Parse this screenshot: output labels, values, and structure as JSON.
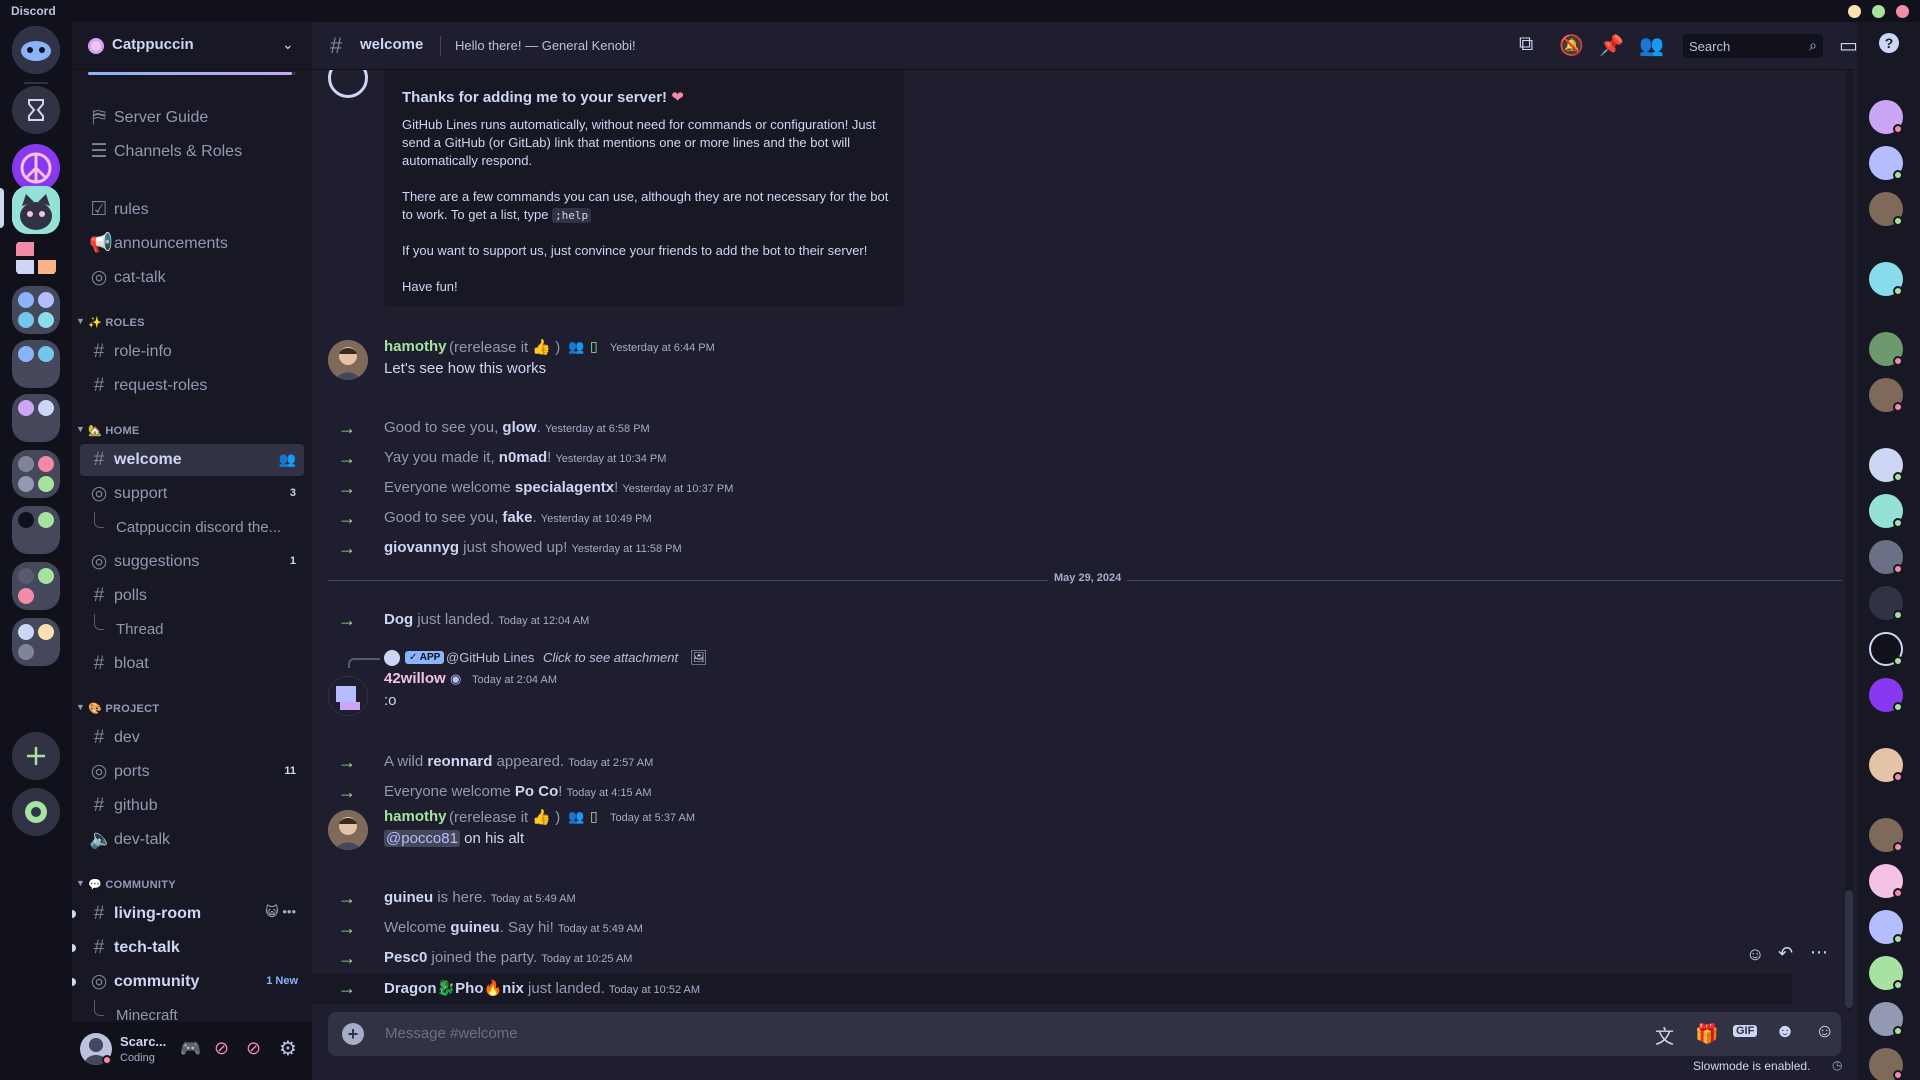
{
  "app": {
    "name": "Discord"
  },
  "server": {
    "name": "Catppuccin"
  },
  "sidebar": {
    "top_items": [
      {
        "label": "Server Guide",
        "icon": "signpost-icon"
      },
      {
        "label": "Channels & Roles",
        "icon": "list-search-icon"
      }
    ],
    "channels_top": [
      {
        "label": "rules",
        "icon": "checkbox-icon"
      },
      {
        "label": "announcements",
        "icon": "megaphone-icon"
      },
      {
        "label": "cat-talk",
        "icon": "forum-icon"
      }
    ],
    "categories": [
      {
        "label": "ROLES",
        "emoji": "✨",
        "channels": [
          {
            "label": "role-info",
            "icon": "hash-icon"
          },
          {
            "label": "request-roles",
            "icon": "hash-icon"
          }
        ]
      },
      {
        "label": "HOME",
        "emoji": "🏡",
        "channels": [
          {
            "label": "welcome",
            "icon": "hash-icon",
            "active": true
          },
          {
            "label": "support",
            "icon": "forum-icon",
            "count": "3"
          },
          {
            "label": "Catppuccin discord the...",
            "thread": true
          },
          {
            "label": "suggestions",
            "icon": "forum-icon",
            "count": "1"
          },
          {
            "label": "polls",
            "icon": "hash-icon"
          },
          {
            "label": "Thread",
            "thread": true
          },
          {
            "label": "bloat",
            "icon": "hash-icon"
          }
        ]
      },
      {
        "label": "PROJECT",
        "emoji": "🎨",
        "channels": [
          {
            "label": "dev",
            "icon": "hash-icon"
          },
          {
            "label": "ports",
            "icon": "forum-icon",
            "count": "11"
          },
          {
            "label": "github",
            "icon": "hash-icon"
          },
          {
            "label": "dev-talk",
            "icon": "speaker-icon"
          }
        ]
      },
      {
        "label": "COMMUNITY",
        "emoji": "💬",
        "channels": [
          {
            "label": "living-room",
            "icon": "hash-icon",
            "unread": true
          },
          {
            "label": "tech-talk",
            "icon": "hash-icon",
            "unread": true
          },
          {
            "label": "community",
            "icon": "forum-icon",
            "unread": true,
            "badge": "1 New"
          },
          {
            "label": "Minecraft",
            "thread": true
          }
        ]
      }
    ]
  },
  "user": {
    "name": "Scarc...",
    "status": "Coding"
  },
  "channel": {
    "name": "welcome",
    "topic": "Hello there! — General Kenobi!"
  },
  "header": {
    "search_placeholder": "Search"
  },
  "bot_embed": {
    "title": "Thanks for adding me to your server!",
    "p1": "GitHub Lines runs automatically, without need for commands or configuration! Just send a GitHub (or GitLab) link that mentions one or more lines and the bot will automatically respond.",
    "p2a": "There are a few commands you can use, although they are not necessary for the bot to work. To get a list, type ",
    "p2code": ";help",
    "p3": "If you want to support us, just convince your friends to add the bot to their server!",
    "p4": "Have fun!"
  },
  "messages": {
    "m1": {
      "user": "hamothy",
      "tag": "(rerelease it 👍 )",
      "time": "Yesterday at 6:44 PM",
      "text": "Let's see how this works"
    },
    "sys1": [
      {
        "pre": "Good to see you, ",
        "name": "glow",
        "post": ".",
        "time": "Yesterday at 6:58 PM"
      },
      {
        "pre": "Yay you made it, ",
        "name": "n0mad",
        "post": "!",
        "time": "Yesterday at 10:34 PM"
      },
      {
        "pre": "Everyone welcome ",
        "name": "specialagentx",
        "post": "!",
        "time": "Yesterday at 10:37 PM"
      },
      {
        "pre": "Good to see you, ",
        "name": "fake",
        "post": ".",
        "time": "Yesterday at 10:49 PM"
      },
      {
        "pre": "",
        "name": "giovannyg",
        "post": " just showed up!",
        "time": "Yesterday at 11:58 PM"
      }
    ],
    "divider": "May 29, 2024",
    "sys2": [
      {
        "pre": "",
        "name": "Dog",
        "post": " just landed.",
        "time": "Today at 12:04 AM"
      }
    ],
    "reply": {
      "app_badge": "✓ APP",
      "ref_user": "@GitHub Lines",
      "ref_text": "Click to see attachment",
      "user": "42willow",
      "time": "Today at 2:04 AM",
      "text": ":o"
    },
    "sys3": [
      {
        "pre": "A wild ",
        "name": "reonnard",
        "post": " appeared.",
        "time": "Today at 2:57 AM"
      },
      {
        "pre": "Everyone welcome ",
        "name": "Po Co",
        "post": "!",
        "time": "Today at 4:15 AM"
      }
    ],
    "m2": {
      "user": "hamothy",
      "tag": "(rerelease it 👍 )",
      "time": "Today at 5:37 AM",
      "mention": "@pocco81",
      "text": " on his alt"
    },
    "sys4": [
      {
        "pre": "",
        "name": "guineu",
        "post": " is here.",
        "time": "Today at 5:49 AM"
      },
      {
        "pre": "Welcome ",
        "name": "guineu",
        "post": ". Say hi!",
        "time": "Today at 5:49 AM"
      },
      {
        "pre": "",
        "name": "Pesc0",
        "post": " joined the party.",
        "time": "Today at 10:25 AM"
      },
      {
        "pre": "",
        "name": "Dragon🐉Pho🔥nix",
        "post": " just landed.",
        "time": "Today at 10:52 AM"
      }
    ]
  },
  "composer": {
    "placeholder": "Message #welcome",
    "slowmode": "Slowmode is enabled."
  },
  "colors": {
    "base": "#1e1e2e",
    "mantle": "#181825",
    "crust": "#11111b",
    "accent": "#89b4fa",
    "green": "#a6e3a1",
    "teal": "#94e2d5",
    "pink": "#f5c2e7"
  }
}
